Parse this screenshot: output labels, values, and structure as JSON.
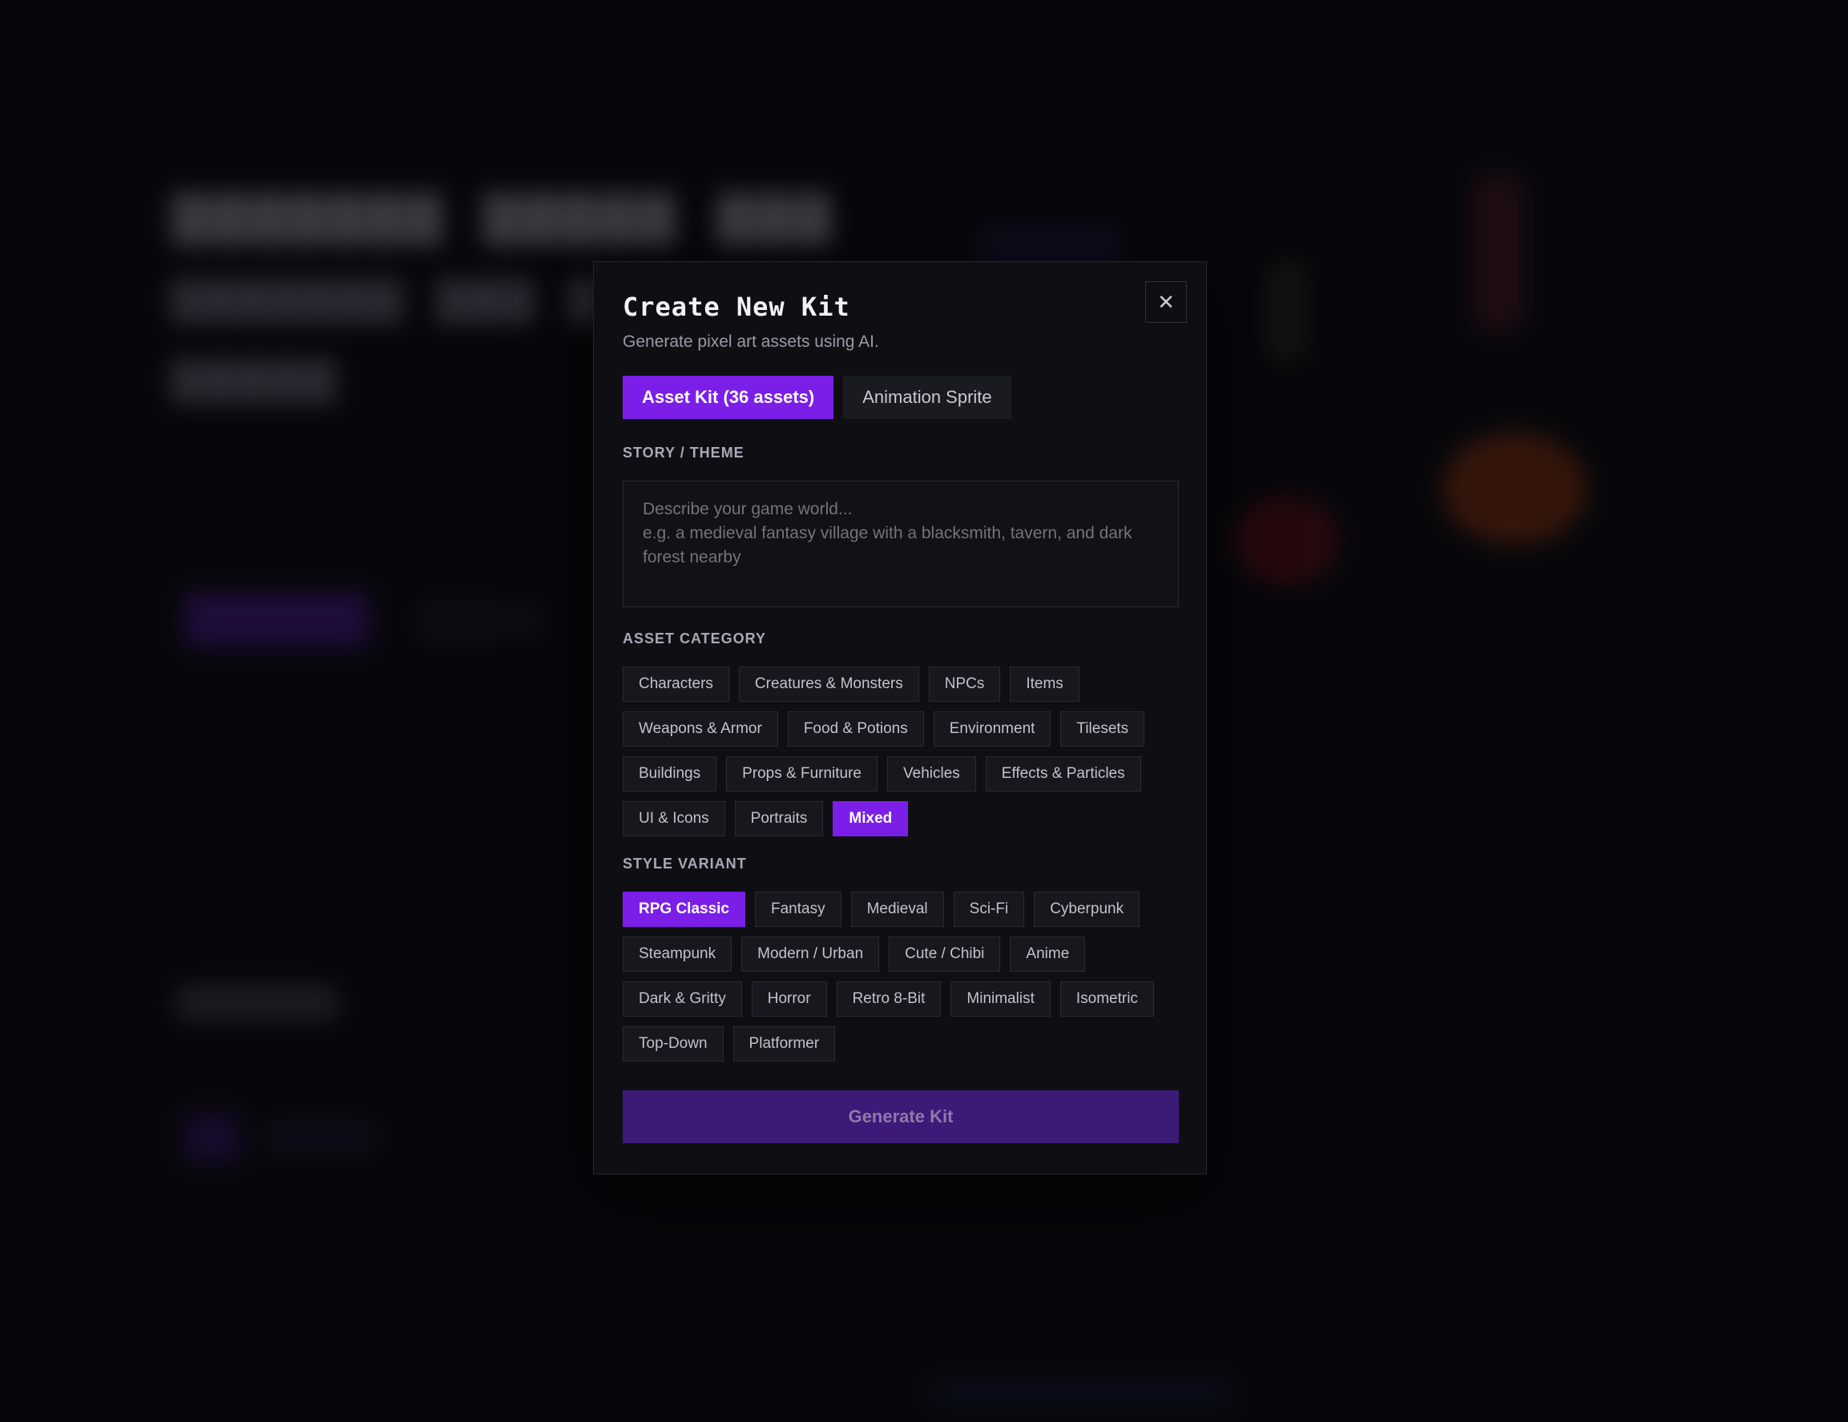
{
  "modal": {
    "title": "Create New Kit",
    "subtitle": "Generate pixel art assets using AI.",
    "close_icon": "close-icon",
    "close_glyph": "✕"
  },
  "mode_tabs": [
    {
      "label": "Asset Kit (36 assets)",
      "active": true
    },
    {
      "label": "Animation Sprite",
      "active": false
    }
  ],
  "story": {
    "label": "STORY / THEME",
    "placeholder": "Describe your game world...\ne.g. a medieval fantasy village with a blacksmith, tavern, and dark forest nearby",
    "value": ""
  },
  "category": {
    "label": "ASSET CATEGORY",
    "options": [
      "Characters",
      "Creatures & Monsters",
      "NPCs",
      "Items",
      "Weapons & Armor",
      "Food & Potions",
      "Environment",
      "Tilesets",
      "Buildings",
      "Props & Furniture",
      "Vehicles",
      "Effects & Particles",
      "UI & Icons",
      "Portraits",
      "Mixed"
    ],
    "selected": "Mixed"
  },
  "style": {
    "label": "STYLE VARIANT",
    "options": [
      "RPG Classic",
      "Fantasy",
      "Medieval",
      "Sci-Fi",
      "Cyberpunk",
      "Steampunk",
      "Modern / Urban",
      "Cute / Chibi",
      "Anime",
      "Dark & Gritty",
      "Horror",
      "Retro 8-Bit",
      "Minimalist",
      "Isometric",
      "Top-Down",
      "Platformer"
    ],
    "selected": "RPG Classic"
  },
  "generate_button": {
    "label": "Generate Kit"
  },
  "colors": {
    "accent": "#7b1ee8",
    "accent_disabled": "#3b1a78",
    "modal_bg": "#0f0f13",
    "page_bg": "#0a0a0e"
  }
}
